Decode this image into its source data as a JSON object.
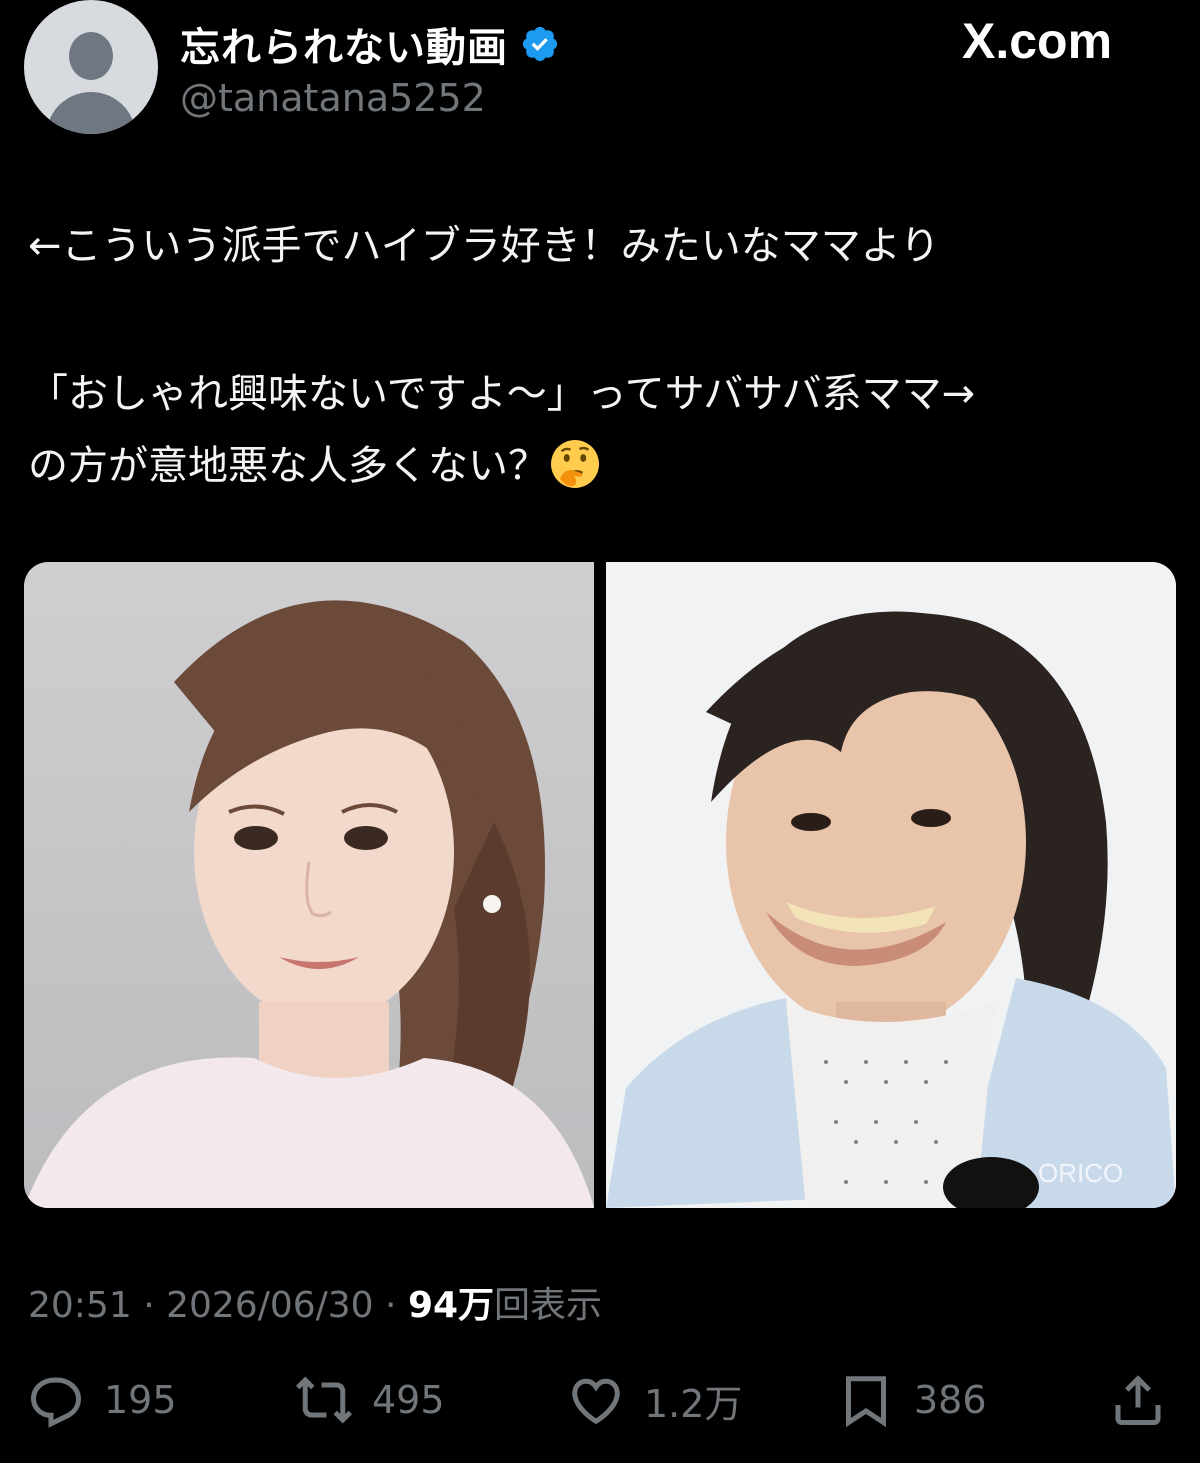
{
  "header": {
    "display_name": "忘れられない動画",
    "handle": "@tanatana5252",
    "site": "X.com",
    "verified_icon": "verified-badge-icon",
    "accent_color": "#1d9bf0"
  },
  "tweet": {
    "line1": "←こういう派手でハイブラ好き！みたいなママより",
    "line2": "「おしゃれ興味ないですよ〜」ってサバサバ系ママ→",
    "line3": "の方が意地悪な人多くない？",
    "emoji": "thinking-face-emoji"
  },
  "media": {
    "watermark": "ORICO"
  },
  "meta": {
    "time": "20:51",
    "date": "2026/06/30",
    "sep": " · ",
    "views_count": "94万",
    "views_label": "回表示"
  },
  "actions": {
    "replies": "195",
    "reposts": "495",
    "likes": "1.2万",
    "bookmarks": "386"
  }
}
